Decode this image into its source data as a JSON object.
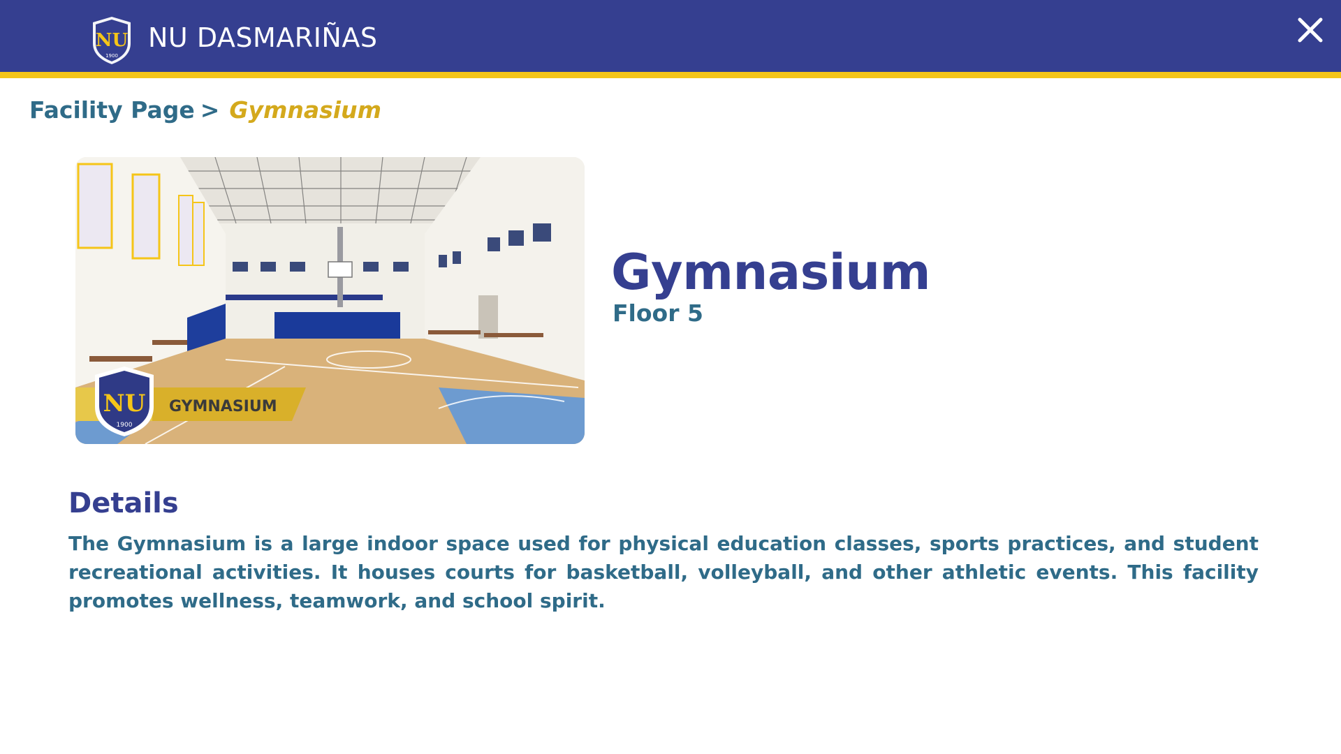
{
  "header": {
    "brand": "NU DASMARIÑAS",
    "logo_year": "1900",
    "close_icon": "close-icon",
    "colors": {
      "bar": "#353f90",
      "accent": "#f5c518"
    }
  },
  "breadcrumb": {
    "parent": "Facility Page",
    "separator": ">",
    "current": "Gymnasium"
  },
  "facility": {
    "photo_banner": "GYMNASIUM",
    "photo_logo_year": "1900",
    "title": "Gymnasium",
    "floor": "Floor 5"
  },
  "details": {
    "heading": "Details",
    "text": "The Gymnasium is a large indoor space used for physical education classes, sports practices, and student recreational activities. It houses courts for basketball, volleyball, and other athletic events. This facility promotes wellness, teamwork, and school spirit."
  }
}
